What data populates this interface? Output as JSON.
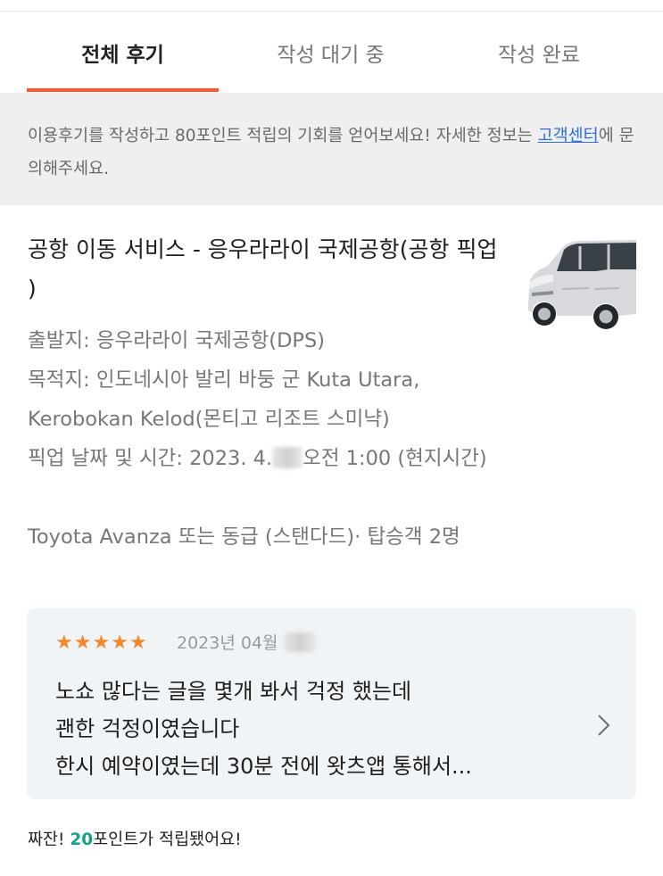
{
  "tabs": [
    {
      "label": "전체 후기",
      "active": true
    },
    {
      "label": "작성 대기 중",
      "active": false
    },
    {
      "label": "작성 완료",
      "active": false
    }
  ],
  "notice": {
    "text_before": "이용후기를 작성하고 80포인트 적립의 기회를 얻어보세요! 자세한 정보는 ",
    "link_text": "고객센터",
    "text_after": "에 문의해주세요."
  },
  "product": {
    "title": "공항 이동 서비스 - 응우라라이 국제공항(공항 픽업 )",
    "departure": "출발지: 응우라라이 국제공항(DPS)",
    "destination": "목적지: 인도네시아 발리 바둥 군 Kuta Utara, Kerobokan Kelod(몬티고 리조트 스미냑)",
    "pickup_prefix": "픽업 날짜 및 시간:  2023. 4.",
    "pickup_suffix": "오전 1:00 (현지시간)",
    "vehicle": "Toyota Avanza  또는 동급 (스탠다드)· 탑승객 2명",
    "image_icon": "car-photo"
  },
  "review": {
    "rating": 5,
    "stars": [
      "★",
      "★",
      "★",
      "★",
      "★"
    ],
    "date_prefix": "2023년 04월",
    "line1": "노쇼 많다는 글을 몇개 봐서 걱정 했는데",
    "line2": "괜한 걱정이였습니다",
    "line3": "한시 예약이였는데 30분 전에 왓츠앱 통해서...",
    "chevron_icon": "chevron-right-icon"
  },
  "points": {
    "prefix": "짜잔! ",
    "amount": "20",
    "suffix": "포인트가 적립됐어요!"
  },
  "colors": {
    "accent": "#f4582e",
    "star": "#f4882f",
    "link": "#2f6fd6",
    "points": "#14a287"
  }
}
